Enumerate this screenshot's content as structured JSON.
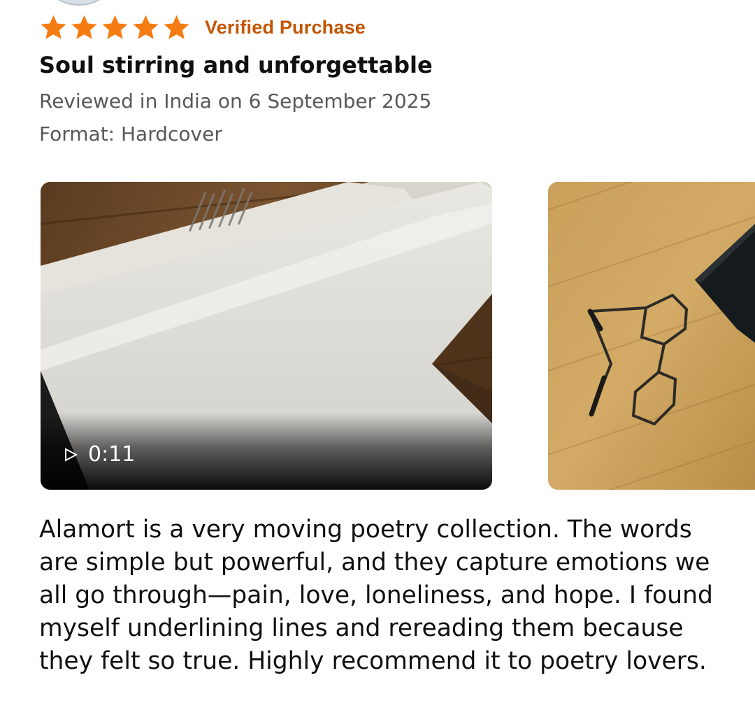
{
  "review": {
    "rating": 5,
    "rating_max": 5,
    "star_color": "#f47c13",
    "verified_label": "Verified Purchase",
    "verified_color": "#c45500",
    "title": "Soul stirring and unforgettable",
    "reviewed_line": "Reviewed in India on 6 September 2025",
    "format_line": "Format: Hardcover",
    "media": {
      "video": {
        "duration": "0:11",
        "play_icon": "play-outline-icon"
      },
      "photo": {}
    },
    "body": "Alamort is a very moving poetry collection. The words are simple but powerful, and they capture emotions we all go through—pain, love, loneliness, and hope. I found myself underlining lines and rereading them because they felt so true. Highly recommend it to poetry lovers."
  }
}
